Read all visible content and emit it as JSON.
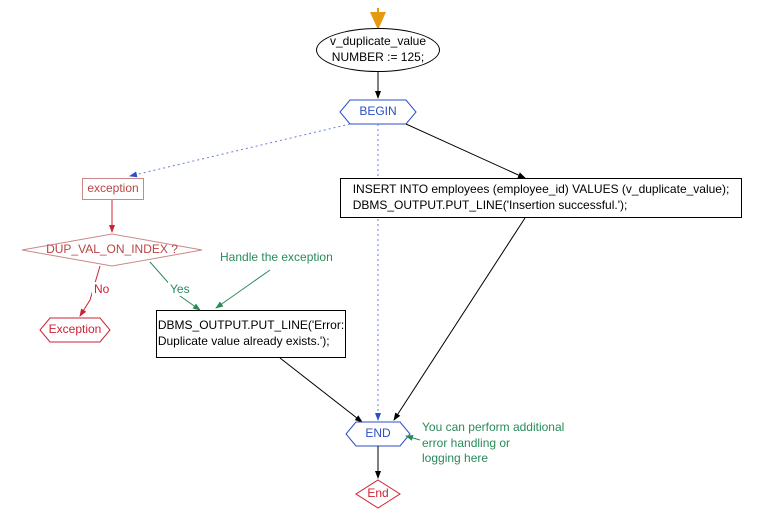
{
  "nodes": {
    "start_decl": "v_duplicate_value\nNUMBER := 125;",
    "begin": "BEGIN",
    "insert_block": "INSERT INTO employees (employee_id) VALUES (v_duplicate_value);\nDBMS_OUTPUT.PUT_LINE('Insertion successful.');",
    "exception": "exception",
    "dup_check": "DUP_VAL_ON_INDEX ?",
    "exception_terminal": "Exception",
    "handler_block": "DBMS_OUTPUT.PUT_LINE('Error: Duplicate value already exists.');",
    "end": "END",
    "end_terminal": "End"
  },
  "edge_labels": {
    "no": "No",
    "yes": "Yes"
  },
  "comments": {
    "handle_exc": "Handle the exception",
    "additional": "You can perform additional\nerror handling or\nlogging here"
  }
}
